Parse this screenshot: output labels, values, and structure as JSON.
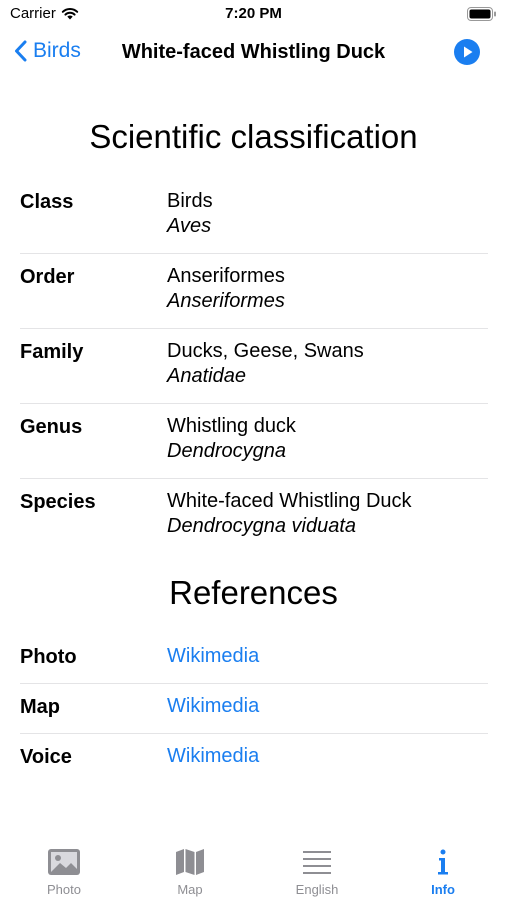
{
  "status": {
    "carrier": "Carrier",
    "time": "7:20 PM"
  },
  "nav": {
    "back_label": "Birds",
    "title": "White-faced Whistling Duck"
  },
  "classification": {
    "heading": "Scientific classification",
    "rows": [
      {
        "label": "Class",
        "common": "Birds",
        "scientific": "Aves"
      },
      {
        "label": "Order",
        "common": "Anseriformes",
        "scientific": "Anseriformes"
      },
      {
        "label": "Family",
        "common": "Ducks, Geese, Swans",
        "scientific": "Anatidae"
      },
      {
        "label": "Genus",
        "common": "Whistling duck",
        "scientific": "Dendrocygna"
      },
      {
        "label": "Species",
        "common": "White-faced Whistling Duck",
        "scientific": "Dendrocygna viduata"
      }
    ]
  },
  "references": {
    "heading": "References",
    "rows": [
      {
        "label": "Photo",
        "link": "Wikimedia"
      },
      {
        "label": "Map",
        "link": "Wikimedia"
      },
      {
        "label": "Voice",
        "link": "Wikimedia"
      }
    ]
  },
  "tabs": [
    {
      "label": "Photo",
      "icon": "photo-icon"
    },
    {
      "label": "Map",
      "icon": "map-icon"
    },
    {
      "label": "English",
      "icon": "list-icon"
    },
    {
      "label": "Info",
      "icon": "info-icon",
      "active": true
    }
  ],
  "colors": {
    "accent": "#1a7ef0",
    "inactive": "#8e8e93"
  }
}
